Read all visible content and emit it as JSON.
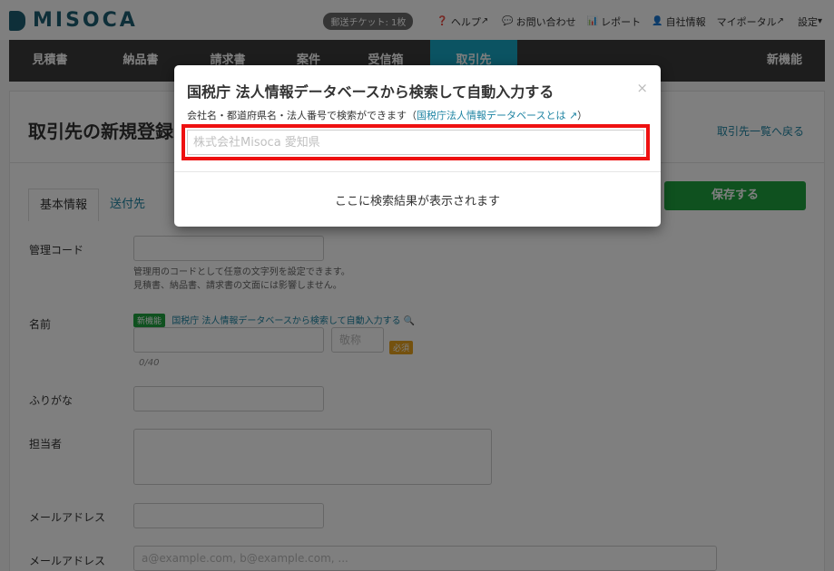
{
  "app": {
    "logo_text": "MISOCA",
    "brand_color": "#1d5f73",
    "accent_color": "#16a6c4"
  },
  "topnav": {
    "ticket_badge": "郵送チケット: 1枚",
    "items": [
      {
        "icon": "help-circle-icon",
        "label": "ヘルプ",
        "external": true
      },
      {
        "icon": "chat-bubble-icon",
        "label": "お問い合わせ"
      },
      {
        "icon": "bar-chart-icon",
        "label": "レポート"
      },
      {
        "icon": "user-icon",
        "label": "自社情報"
      },
      {
        "icon": null,
        "label": "マイポータル",
        "external": true
      },
      {
        "icon": null,
        "label": "設定",
        "dropdown": true
      }
    ]
  },
  "mainnav": {
    "items": [
      "見積書",
      "納品書",
      "請求書",
      "案件",
      "受信箱",
      "取引先",
      "新機能"
    ],
    "active": "取引先"
  },
  "page": {
    "title": "取引先の新規登録",
    "back_link": "取引先一覧へ戻る",
    "tabs": [
      "基本情報",
      "送付先"
    ],
    "save_button": "保存する",
    "fields": {
      "code_label": "管理コード",
      "code_help_1": "管理用のコードとして任意の文字列を設定できます。",
      "code_help_2": "見積書、納品書、請求書の文面には影響しません。",
      "name_label": "名前",
      "new_badge": "新機能",
      "feature_link": "国税庁 法人情報データベースから検索して自動入力する",
      "honorific_placeholder": "敬称",
      "required_badge": "必須",
      "name_counter": "0/40",
      "furigana_label": "ふりがな",
      "person_label": "担当者",
      "email_label_1": "メールアドレス",
      "email_label_2": "メールアドレス",
      "email_placeholder": "a@example.com, b@example.com, ..."
    }
  },
  "modal": {
    "title": "国税庁 法人情報データベースから検索して自動入力する",
    "close": "×",
    "description_prefix": "会社名・都道府県名・法人番号で検索ができます（",
    "description_link": "国税庁法人情報データベースとは",
    "description_suffix": "）",
    "search_placeholder": "株式会社Misoca 愛知県",
    "search_value": "",
    "result_hint": "ここに検索結果が表示されます",
    "highlight_color": "#ee1111"
  }
}
